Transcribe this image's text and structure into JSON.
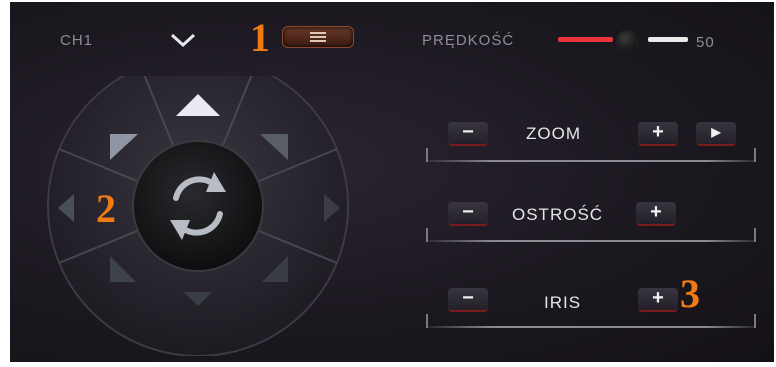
{
  "header": {
    "channel": "CH1",
    "menu_icon": "list-icon",
    "dropdown_icon": "chevron-down-icon",
    "speed_label": "PRĘDKOŚĆ",
    "speed_value": "50",
    "speed_level": 0.5
  },
  "ptz": {
    "center_icon": "refresh-icon",
    "directions": [
      "up",
      "down",
      "left",
      "right",
      "up-left",
      "up-right",
      "down-left",
      "down-right"
    ]
  },
  "controls": {
    "zoom": {
      "label": "ZOOM",
      "minus": "−",
      "plus": "+",
      "extra_icon": "play-icon",
      "extra": "▶"
    },
    "focus": {
      "label": "OSTROŚĆ",
      "minus": "−",
      "plus": "+"
    },
    "iris": {
      "label": "IRIS",
      "minus": "−",
      "plus": "+"
    }
  },
  "annotations": {
    "a1": "1",
    "a2": "2",
    "a3": "3"
  },
  "colors": {
    "accent_red": "#e8353a",
    "annotation": "#f07a13",
    "background": "#1c1820"
  }
}
